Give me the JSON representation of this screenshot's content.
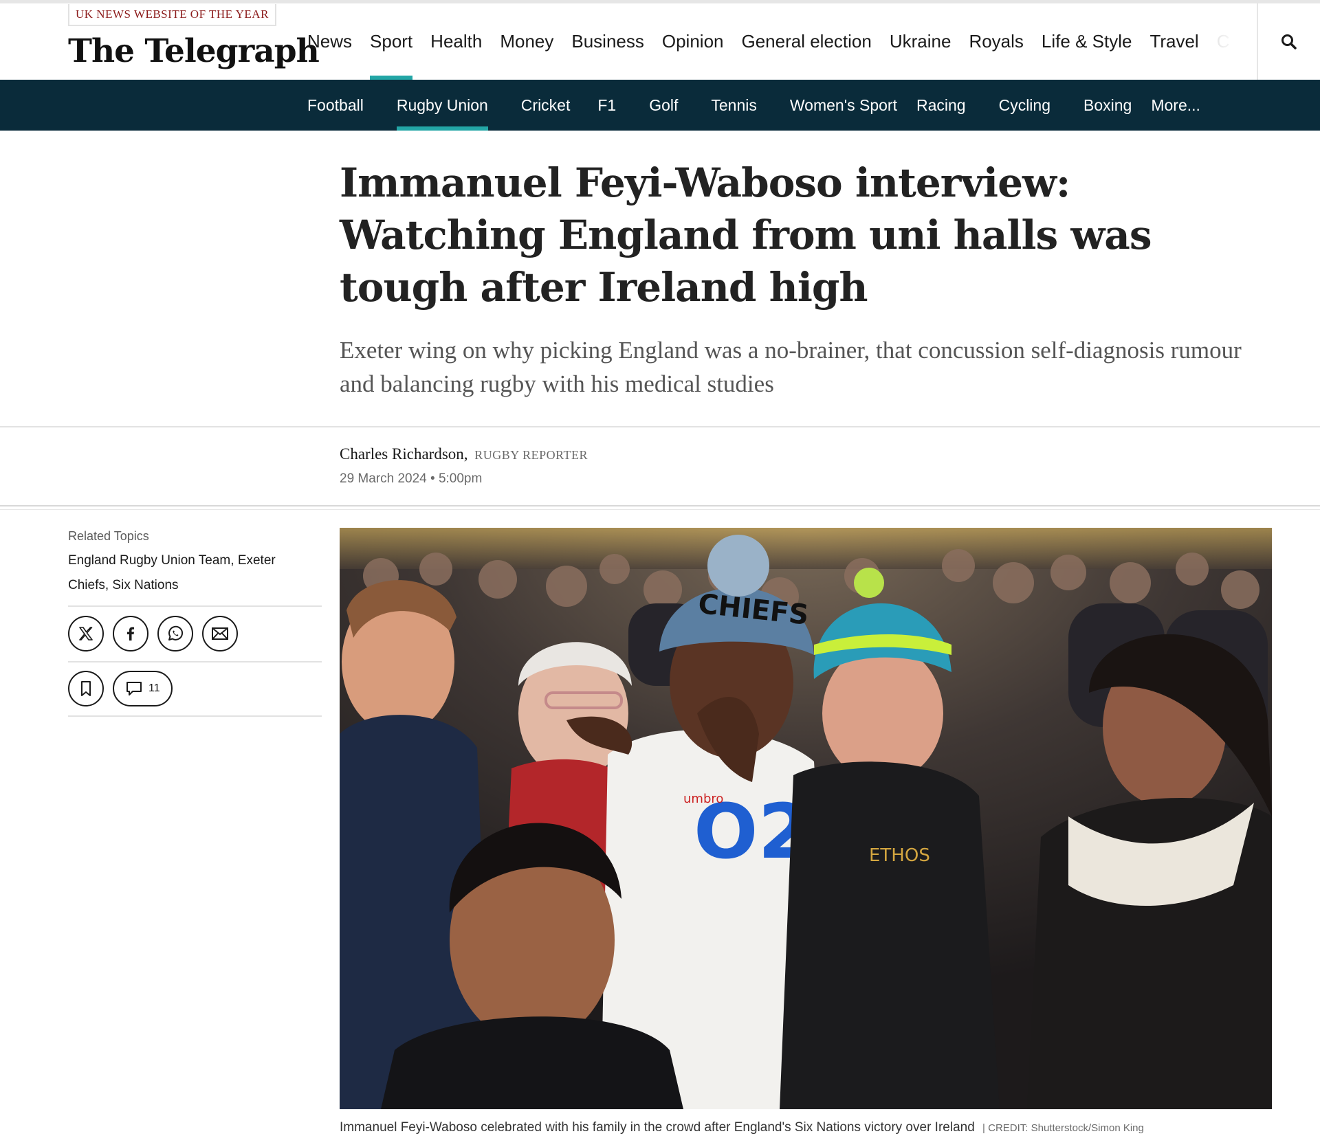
{
  "header": {
    "award": "UK NEWS WEBSITE OF THE YEAR",
    "logo": "The Telegraph",
    "nav": [
      {
        "label": "News",
        "active": false
      },
      {
        "label": "Sport",
        "active": true
      },
      {
        "label": "Health",
        "active": false
      },
      {
        "label": "Money",
        "active": false
      },
      {
        "label": "Business",
        "active": false
      },
      {
        "label": "Opinion",
        "active": false
      },
      {
        "label": "General election",
        "active": false
      },
      {
        "label": "Ukraine",
        "active": false
      },
      {
        "label": "Royals",
        "active": false
      },
      {
        "label": "Life & Style",
        "active": false
      },
      {
        "label": "Travel",
        "active": false
      },
      {
        "label": "C",
        "active": false
      }
    ],
    "search_icon": "search-icon"
  },
  "subnav": [
    {
      "label": "Football",
      "active": false
    },
    {
      "label": "Rugby Union",
      "active": true
    },
    {
      "label": "Cricket",
      "active": false
    },
    {
      "label": "F1",
      "active": false
    },
    {
      "label": "Golf",
      "active": false
    },
    {
      "label": "Tennis",
      "active": false
    },
    {
      "label": "Women's Sport",
      "active": false
    },
    {
      "label": "Racing",
      "active": false
    },
    {
      "label": "Cycling",
      "active": false
    },
    {
      "label": "Boxing",
      "active": false
    },
    {
      "label": "More...",
      "active": false
    }
  ],
  "article": {
    "headline": "Immanuel Feyi-Waboso interview: Watching England from uni halls was tough after Ireland high",
    "standfirst": "Exeter wing on why picking England was a no-brainer, that concussion self-diagnosis rumour and balancing rugby with his medical studies",
    "author": "Charles Richardson,",
    "author_role": "RUGBY REPORTER",
    "date": "29 March 2024 • 5:00pm",
    "caption": "Immanuel Feyi-Waboso celebrated with his family in the crowd after England's Six Nations victory over Ireland",
    "credit": "| CREDIT: Shutterstock/Simon King",
    "photo_text": {
      "hat": "CHIEFS",
      "shirt_sponsor": "O2",
      "kit_brand": "umbro",
      "jacket": "ETHOS"
    }
  },
  "sidebar": {
    "related_label": "Related Topics",
    "topics": [
      "England Rugby Union Team",
      "Exeter Chiefs",
      "Six Nations"
    ],
    "share_icons": [
      "x-icon",
      "facebook-icon",
      "whatsapp-icon",
      "email-icon"
    ],
    "comment_count": "11"
  },
  "colors": {
    "subnav_bg": "#0a2b3a",
    "accent": "#23a6a6",
    "award_red": "#8b1a1a"
  }
}
